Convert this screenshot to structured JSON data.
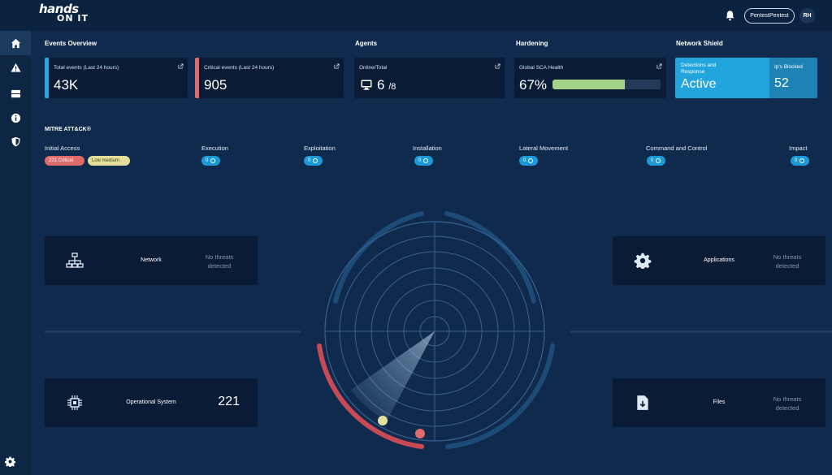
{
  "brand": {
    "line1": "hands",
    "line2": "ON IT"
  },
  "header": {
    "user_name": "PentestPentest",
    "user_initials": "RH"
  },
  "sidebar": {
    "items": [
      {
        "name": "home",
        "active": true
      },
      {
        "name": "alerts",
        "active": false
      },
      {
        "name": "storage",
        "active": false
      },
      {
        "name": "info",
        "active": false
      },
      {
        "name": "shield",
        "active": false
      }
    ]
  },
  "sections": {
    "events_overview": "Events Overview",
    "agents": "Agents",
    "hardening": "Hardening",
    "network_shield": "Network Shield"
  },
  "cards": {
    "total_events": {
      "label": "Total events (Last 24 hours)",
      "value": "43K",
      "accent": "#2aa7de"
    },
    "critical_events": {
      "label": "Critical events (Last 24 hours)",
      "value": "905",
      "accent": "#e06b6b"
    },
    "agents": {
      "label": "Online/Total",
      "online": "6",
      "total": "/8"
    },
    "sca": {
      "label": "Global SCA Health",
      "value": "67%",
      "progress": 0.67,
      "fill_color": "#a3d487"
    },
    "shield": {
      "detection_label": "Detections and Response",
      "detection_value": "Active",
      "ips_label": "Ip's Blocked",
      "ips_value": "52"
    }
  },
  "mitre": {
    "title": "MITRE ATT&CK®",
    "tactics": [
      {
        "name": "Initial Access",
        "badges": [
          {
            "text": "221 Critical",
            "color": "#e06b6b"
          },
          {
            "text": "Low medium",
            "color": "#e4df9a"
          }
        ]
      },
      {
        "name": "Execution",
        "count": "0"
      },
      {
        "name": "Exploitation",
        "count": "0"
      },
      {
        "name": "Installation",
        "count": "0"
      },
      {
        "name": "Lateral Movement",
        "count": "0"
      },
      {
        "name": "Command and Control",
        "count": "0"
      },
      {
        "name": "Impact",
        "count": "0"
      }
    ]
  },
  "threats": {
    "network": {
      "name": "Network",
      "status": "No threats detected"
    },
    "applications": {
      "name": "Applications",
      "status": "No threats detected"
    },
    "os": {
      "name": "Operational System",
      "count": "221"
    },
    "files": {
      "name": "Files",
      "status": "No threats detected"
    }
  }
}
